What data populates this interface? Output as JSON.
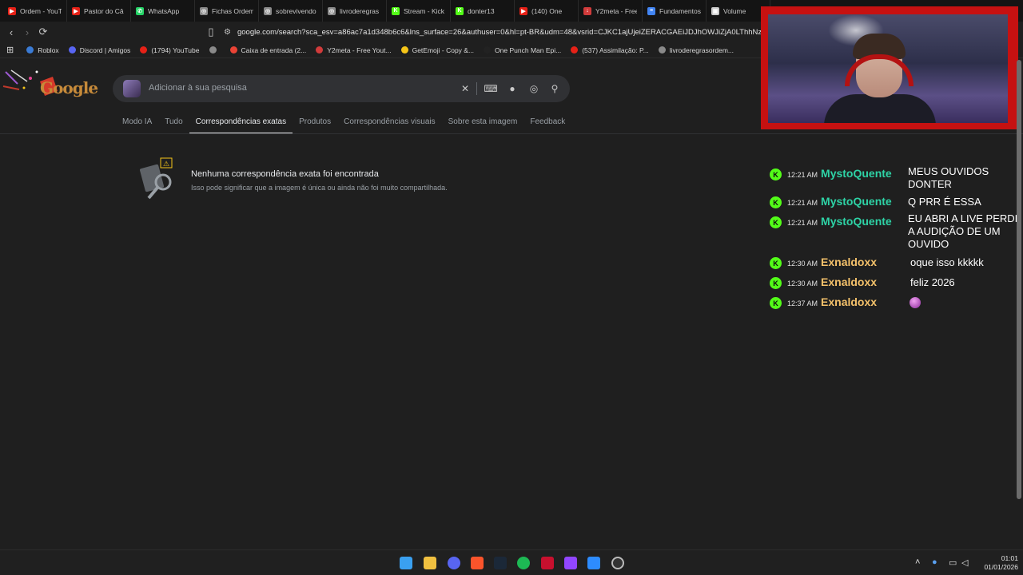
{
  "browser": {
    "tabs": [
      {
        "label": "Ordem - YouT",
        "color": "#e62117",
        "glyph": "▶"
      },
      {
        "label": "Pastor do Câ",
        "color": "#e62117",
        "glyph": "▶"
      },
      {
        "label": "WhatsApp",
        "color": "#25d366",
        "glyph": "✆"
      },
      {
        "label": "Fichas Ordem",
        "color": "#8a8a8a",
        "glyph": "◎"
      },
      {
        "label": "sobrevivendo",
        "color": "#8a8a8a",
        "glyph": "◎"
      },
      {
        "label": "livroderegras",
        "color": "#8a8a8a",
        "glyph": "◎"
      },
      {
        "label": "Stream - Kick",
        "color": "#53fc18",
        "glyph": "K"
      },
      {
        "label": "donter13",
        "color": "#53fc18",
        "glyph": "K"
      },
      {
        "label": "(140) One",
        "color": "#e62117",
        "glyph": "▶"
      },
      {
        "label": "Y2meta - Free",
        "color": "#d13b3b",
        "glyph": "↓"
      },
      {
        "label": "Fundamentos",
        "color": "#4285f4",
        "glyph": "≡"
      },
      {
        "label": "Volume",
        "color": "#cccccc",
        "glyph": "▣"
      }
    ],
    "url": "google.com/search?sca_esv=a86ac7a1d348b6c6&lns_surface=26&authuser=0&hl=pt-BR&udm=48&vsrid=CJKC1ajUjeiZERACGAEiJDJhOWJiZjA0LThhNzM...",
    "bookmarks": [
      {
        "label": "Roblox",
        "color": "#3a7bd5"
      },
      {
        "label": "Discord | Amigos",
        "color": "#5865f2"
      },
      {
        "label": "(1794) YouTube",
        "color": "#e62117"
      },
      {
        "label": "",
        "color": "#8a8a8a"
      },
      {
        "label": "Caixa de entrada (2...",
        "color": "#ea4335"
      },
      {
        "label": "Y2meta - Free Yout...",
        "color": "#d13b3b"
      },
      {
        "label": "GetEmoji - Copy &...",
        "color": "#f5c518"
      },
      {
        "label": "One Punch Man Epi...",
        "color": "#222222"
      },
      {
        "label": "(537) Assimilação: P...",
        "color": "#e62117"
      },
      {
        "label": "livroderegrasordem...",
        "color": "#8a8a8a"
      }
    ]
  },
  "google": {
    "logo_text": "Google",
    "search_placeholder": "Adicionar à sua pesquisa",
    "tabs": [
      "Modo IA",
      "Tudo",
      "Correspondências exatas",
      "Produtos",
      "Correspondências visuais",
      "Sobre esta imagem",
      "Feedback"
    ],
    "active_tab": "Correspondências exatas",
    "no_results_title": "Nenhuma correspondência exata foi encontrada",
    "no_results_sub": "Isso pode significar que a imagem é única ou ainda não foi muito compartilhada."
  },
  "chat": [
    {
      "time": "12:21 AM",
      "user": "MystoQuente",
      "color": "#2ed3a6",
      "message": "MEUS OUVIDOS DONTER"
    },
    {
      "time": "12:21 AM",
      "user": "MystoQuente",
      "color": "#2ed3a6",
      "message": "Q PRR É ESSA"
    },
    {
      "time": "12:21 AM",
      "user": "MystoQuente",
      "color": "#2ed3a6",
      "message": "EU ABRI A LIVE PERDI A AUDIÇÃO DE UM OUVIDO"
    },
    {
      "time": "12:30 AM",
      "user": "Exnaldoxx",
      "color": "#f5c26b",
      "message": "oque isso kkkkk"
    },
    {
      "time": "12:30 AM",
      "user": "Exnaldoxx",
      "color": "#f5c26b",
      "message": "feliz 2026"
    },
    {
      "time": "12:37 AM",
      "user": "Exnaldoxx",
      "color": "#f5c26b",
      "message": ""
    }
  ],
  "taskbar": {
    "time": "01:01",
    "date": "01/01/2026"
  }
}
